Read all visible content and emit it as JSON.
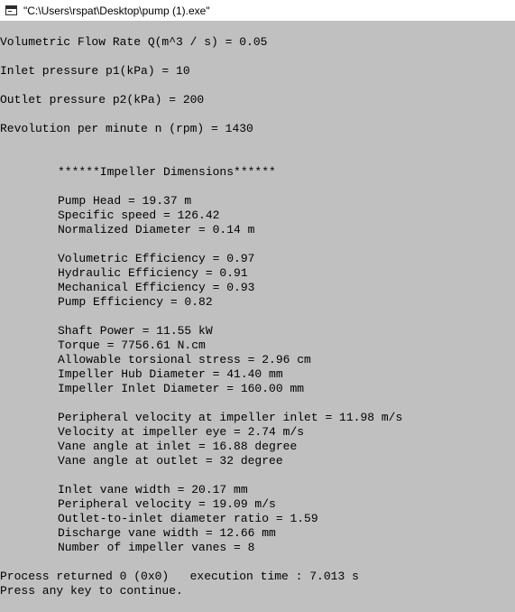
{
  "window": {
    "title": "\"C:\\Users\\rspat\\Desktop\\pump (1).exe\""
  },
  "console": {
    "input": {
      "flow_rate": "Volumetric Flow Rate Q(m^3 / s) = 0.05",
      "inlet_pressure": "Inlet pressure p1(kPa) = 10",
      "outlet_pressure": "Outlet pressure p2(kPa) = 200",
      "rpm": "Revolution per minute n (rpm) = 1430"
    },
    "section_heading": "******Impeller Dimensions******",
    "head_block": [
      "Pump Head = 19.37 m",
      "Specific speed = 126.42",
      "Normalized Diameter = 0.14 m"
    ],
    "efficiency_block": [
      "Volumetric Efficiency = 0.97",
      "Hydraulic Efficiency = 0.91",
      "Mechanical Efficiency = 0.93",
      "Pump Efficiency = 0.82"
    ],
    "power_block": [
      "Shaft Power = 11.55 kW",
      "Torque = 7756.61 N.cm",
      "Allowable torsional stress = 2.96 cm",
      "Impeller Hub Diameter = 41.40 mm",
      "Impeller Inlet Diameter = 160.00 mm"
    ],
    "velocity_block": [
      "Peripheral velocity at impeller inlet = 11.98 m/s",
      "Velocity at impeller eye = 2.74 m/s",
      "Vane angle at inlet = 16.88 degree",
      "Vane angle at outlet = 32 degree"
    ],
    "vane_block": [
      "Inlet vane width = 20.17 mm",
      "Peripheral velocity = 19.09 m/s",
      "Outlet-to-inlet diameter ratio = 1.59",
      "Discharge vane width = 12.66 mm",
      "Number of impeller vanes = 8"
    ],
    "process_returned": "Process returned 0 (0x0)   execution time : 7.013 s",
    "press_key": "Press any key to continue."
  },
  "colors": {
    "console_background": "#c0c0c0",
    "console_text": "#000000",
    "titlebar_background": "#ffffff"
  },
  "icons": {
    "app": "console-window-icon"
  }
}
